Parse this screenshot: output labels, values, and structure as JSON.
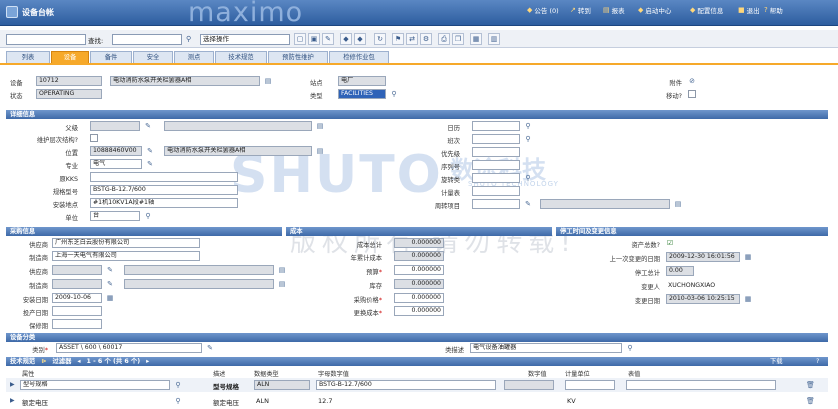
{
  "header": {
    "title": "设备台帐",
    "brand": "maximo",
    "links": [
      {
        "label": "公告 (0)",
        "icon": "bell-icon"
      },
      {
        "label": "转到",
        "icon": "goto-icon"
      },
      {
        "label": "报表",
        "icon": "report-icon"
      },
      {
        "label": "启动中心",
        "icon": "home-icon"
      },
      {
        "label": "配置信息",
        "icon": "profile-icon"
      },
      {
        "label": "退出",
        "icon": "logout-icon"
      },
      {
        "label": "帮助",
        "icon": "help-icon"
      }
    ]
  },
  "toolbar": {
    "query_label": "查找:",
    "action_select": "选择操作"
  },
  "tabs": [
    "列表",
    "设备",
    "备件",
    "安全",
    "测点",
    "技术规范",
    "预防性维护",
    "检修作业包"
  ],
  "asset": {
    "asset_label": "设备",
    "asset_value": "10712",
    "desc": "电动消防水泵开关栏罢器A相",
    "status_label": "状态",
    "status_value": "OPERATING",
    "site_label": "站点",
    "site_value": "电厂",
    "type_label": "类型",
    "type_value": "FACILITIES",
    "attach_label": "附件",
    "mobile_label": "移动?"
  },
  "details": {
    "title": "详细信息",
    "parent_label": "父级",
    "rollup_label": "维护层次结构?",
    "location_label": "位置",
    "location_value": "10888460V00",
    "location_desc": "电动消防水泵开关栏罢器A相",
    "major_label": "专业",
    "major_value": "电气",
    "kks_label": "原KKS",
    "model_label": "规格型号",
    "model_value": "BSTG-B-12.7/600",
    "install_label": "安装地点",
    "install_value": "#1机10KV1A段#1轴",
    "unit_label": "单位",
    "unit_value": "台",
    "calendar_label": "日历",
    "shift_label": "班次",
    "priority_label": "优先级",
    "serial_label": "序列号",
    "spare_label": "旋转类",
    "meter_label": "计量表",
    "rotating_label": "周转项目"
  },
  "purchase": {
    "title": "采购信息",
    "vendor_label": "供应商",
    "vendor_value": "广州东芝白云股份有限公司",
    "mfr_label": "制造商",
    "mfr_value": "上海一天电气有限公司",
    "vendor2_label": "供应商",
    "mfr2_label": "制造商",
    "install_date_label": "安装日期",
    "install_date_value": "2009-10-06",
    "inservice_label": "投产日期",
    "warranty_label": "保修期"
  },
  "cost": {
    "title": "成本",
    "total_label": "成本总计",
    "total_value": "0.000000",
    "ytd_label": "年累计成本",
    "ytd_value": "0.000000",
    "budget_label": "预算",
    "budget_value": "0.000000",
    "inv_label": "库存",
    "inv_value": "0.000000",
    "purchase_label": "采购价格",
    "purchase_value": "0.000000",
    "replace_label": "更换成本",
    "replace_value": "0.000000"
  },
  "change": {
    "title": "停工时间及变更信息",
    "asset_up_label": "资产总数?",
    "last_change_label": "上一次变更的日期",
    "last_change_value": "2009-12-30 16:01:56",
    "downtime_label": "停工总计",
    "downtime_value": "0.00",
    "changedby_label": "变更人",
    "changedby_value": "XUCHONGXIAO",
    "changedate_label": "变更日期",
    "changedate_value": "2010-03-06 10:25:15"
  },
  "classif": {
    "title": "设备分类",
    "class_label": "类别",
    "class_value": "ASSET \\ 600 \\ 60017",
    "desc_label": "类描述",
    "desc_value": "电气设备油罐器"
  },
  "specs": {
    "title": "技术规范",
    "filter": "过滤器",
    "pager": "1 - 6 个 (共 6 个)",
    "download": "下载",
    "cols": [
      "属性",
      "描述",
      "数据类型",
      "字母数字值",
      "数字值",
      "计量单位",
      "表值"
    ],
    "rows": [
      {
        "attr": "型号规格",
        "desc": "型号规格",
        "type": "ALN",
        "value": "BSTG-B-12.7/600",
        "unit": ""
      },
      {
        "attr": "额定电压",
        "desc": "额定电压",
        "type": "ALN",
        "value": "12.7",
        "unit": "KV"
      }
    ]
  },
  "watermark": {
    "cn": "数途科技",
    "en": "SHUTO TECHNOLOGY",
    "logo": "SHUTO",
    "copyright": "版权所有 请勿转载!"
  }
}
